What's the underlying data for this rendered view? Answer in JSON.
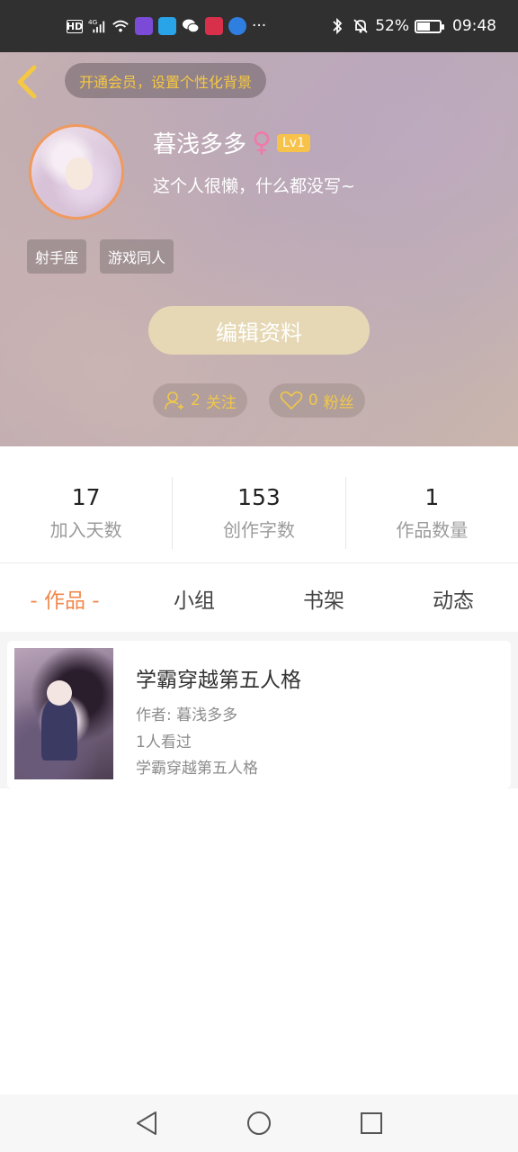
{
  "status_bar": {
    "left_icons": [
      "hd-icon",
      "4g-signal-icon",
      "wifi-icon",
      "app-icon-1",
      "app-icon-2",
      "wechat-icon",
      "app-icon-3",
      "app-icon-4"
    ],
    "more": "···",
    "battery_percent": "52%",
    "battery_level": 0.52,
    "time": "09:48"
  },
  "header": {
    "vip_banner": "开通会员，设置个性化背景",
    "username": "暮浅多多",
    "gender_symbol": "♀",
    "level": "Lv1",
    "bio": "这个人很懒，什么都没写~",
    "tags": [
      "射手座",
      "游戏同人"
    ],
    "edit_button": "编辑资料",
    "following_count": "2",
    "following_label": "关注",
    "followers_count": "0",
    "followers_label": "粉丝"
  },
  "stats": [
    {
      "value": "17",
      "label": "加入天数"
    },
    {
      "value": "153",
      "label": "创作字数"
    },
    {
      "value": "1",
      "label": "作品数量"
    }
  ],
  "tabs": [
    {
      "label": "- 作品 -",
      "active": true
    },
    {
      "label": "小组",
      "active": false
    },
    {
      "label": "书架",
      "active": false
    },
    {
      "label": "动态",
      "active": false
    }
  ],
  "works": [
    {
      "title": "学霸穿越第五人格",
      "author": "作者: 暮浅多多",
      "views": "1人看过",
      "summary": "学霸穿越第五人格"
    }
  ],
  "colors": {
    "accent": "#f0894b",
    "gold": "#f0c84a",
    "level_badge": "#f6c24a",
    "edit_button": "#e6d8b5"
  }
}
